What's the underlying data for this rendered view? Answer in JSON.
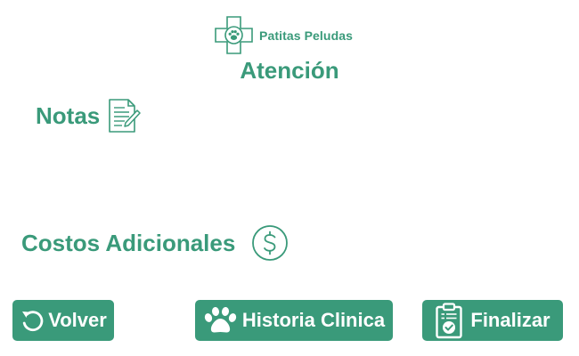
{
  "brand": {
    "name": "Patitas Peludas",
    "logo_icon": "cross-paw-icon"
  },
  "header": {
    "title": "Atención"
  },
  "notes": {
    "label": "Notas",
    "icon": "notes-document-icon"
  },
  "costs": {
    "label": "Costos Adicionales",
    "icon": "dollar-circle-icon"
  },
  "actions": {
    "back_label": "Volver",
    "back_icon": "refresh-icon",
    "history_label": "Historia Clinica",
    "history_icon": "paw-icon",
    "finish_label": "Finalizar",
    "finish_icon": "clipboard-check-icon"
  },
  "colors": {
    "accent": "#3a9a7a",
    "background": "#ffffff",
    "button_text": "#ffffff"
  }
}
